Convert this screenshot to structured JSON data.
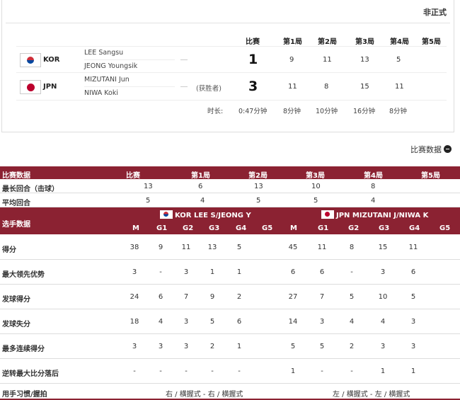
{
  "status": "非正式",
  "scoreboard": {
    "headers": [
      "比赛",
      "第1局",
      "第2局",
      "第3局",
      "第4局",
      "第5局"
    ],
    "teams": [
      {
        "code": "KOR",
        "players": [
          "LEE Sangsu",
          "JEONG Youngsik"
        ],
        "winner": "",
        "match": "1",
        "games": [
          "9",
          "11",
          "13",
          "5",
          ""
        ]
      },
      {
        "code": "JPN",
        "players": [
          "MIZUTANI Jun",
          "NIWA Koki"
        ],
        "winner": "(获胜者)",
        "match": "3",
        "games": [
          "11",
          "8",
          "15",
          "11",
          ""
        ]
      }
    ],
    "duration_label": "时长:",
    "durations": [
      "0:47分钟",
      "8分钟",
      "10分钟",
      "16分钟",
      "8分钟"
    ]
  },
  "stats_title": "比赛数据",
  "match_stats": {
    "header": [
      "比赛数据",
      "比赛",
      "第1局",
      "第2局",
      "第3局",
      "第4局",
      "第5局"
    ],
    "rows": [
      {
        "label": "最长回合（击球）",
        "values": [
          "13",
          "6",
          "13",
          "10",
          "8",
          ""
        ]
      },
      {
        "label": "平均回合",
        "values": [
          "5",
          "4",
          "5",
          "5",
          "4",
          ""
        ]
      }
    ]
  },
  "player_stats": {
    "label": "选手数据",
    "team_a": "KOR LEE S/JEONG Y",
    "team_b": "JPN MIZUTANI J/NIWA K",
    "subheaders": [
      "M",
      "G1",
      "G2",
      "G3",
      "G4",
      "G5",
      "M",
      "G1",
      "G2",
      "G3",
      "G4",
      "G5"
    ],
    "rows": [
      {
        "label": "得分",
        "values": [
          "38",
          "9",
          "11",
          "13",
          "5",
          "",
          "45",
          "11",
          "8",
          "15",
          "11",
          ""
        ]
      },
      {
        "label": "最大领先优势",
        "values": [
          "3",
          "-",
          "3",
          "1",
          "1",
          "",
          "6",
          "6",
          "-",
          "3",
          "6",
          ""
        ]
      },
      {
        "label": "发球得分",
        "values": [
          "24",
          "6",
          "7",
          "9",
          "2",
          "",
          "27",
          "7",
          "5",
          "10",
          "5",
          ""
        ]
      },
      {
        "label": "发球失分",
        "values": [
          "18",
          "4",
          "3",
          "5",
          "6",
          "",
          "14",
          "3",
          "4",
          "4",
          "3",
          ""
        ]
      },
      {
        "label": "最多连续得分",
        "values": [
          "3",
          "3",
          "3",
          "2",
          "1",
          "",
          "5",
          "5",
          "2",
          "3",
          "3",
          ""
        ]
      },
      {
        "label": "逆转最大比分落后",
        "values": [
          "-",
          "-",
          "-",
          "-",
          "-",
          "",
          "1",
          "-",
          "-",
          "1",
          "1",
          ""
        ]
      }
    ],
    "grip_label": "用手习惯/握拍",
    "grip_a": "右 / 横握式 - 右 / 横握式",
    "grip_b": "左 / 横握式 - 左 / 横握式"
  }
}
